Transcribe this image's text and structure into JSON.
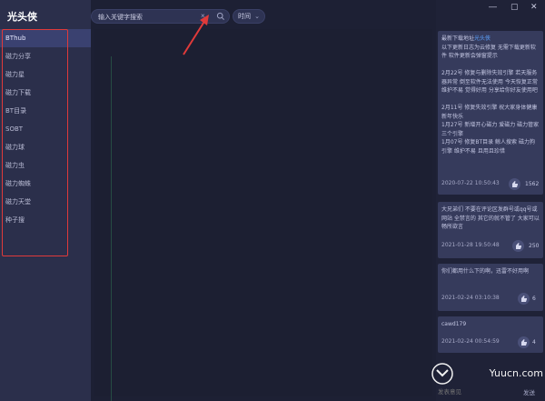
{
  "app": {
    "title": "光头侠"
  },
  "sidebar": {
    "items": [
      {
        "label": "BThub",
        "active": true
      },
      {
        "label": "磁力分享"
      },
      {
        "label": "磁力星"
      },
      {
        "label": "磁力下载"
      },
      {
        "label": "BT目录"
      },
      {
        "label": "SOBT"
      },
      {
        "label": "磁力球"
      },
      {
        "label": "磁力虫"
      },
      {
        "label": "磁力蜘蛛"
      },
      {
        "label": "磁力天堂"
      },
      {
        "label": "种子搜"
      }
    ],
    "highlight_color": "#e03a3a"
  },
  "search": {
    "placeholder": "输入关键字搜索",
    "sort_label": "时间"
  },
  "notices": [
    {
      "text_prefix": "最新下载地址",
      "link": "光头侠",
      "text": "\n以下更新日志为云修复 无需下载更新软件 软件更新会弹窗提示\n\n2月22号 修复与删除失效引擎 若天服务器异常 倒至软件无法使用 今天恢复正常 维护不易 觉得好用 分享给你好友使用吧\n\n2月11号 修复失效引擎 祝大家身体健康 新年快乐\n1月27号 新增开心磁力 爱磁力 磁力管家三个引擎\n1月07号 修复BT目录 鲸人搜索 磁力狗引擎 维护不易 且用且珍惜",
      "date": "2020-07-22 10:50:43",
      "likes": "1562"
    },
    {
      "text": "大兄弟们 不要在评论区发群号或qq号或网站 全禁言的 其它的就不管了 大家可以畅所欲言",
      "date": "2021-01-28 19:50:48",
      "likes": "250"
    },
    {
      "text": "你们都用什么下的啊，迅雷不好用啊",
      "date": "2021-02-24 03:10:38",
      "likes": "6"
    },
    {
      "text": "cawd179",
      "date": "2021-02-24 00:54:59",
      "likes": "4"
    }
  ],
  "feedback": {
    "placeholder": "发表意见",
    "send_label": "发送"
  },
  "window": {
    "minimize": "—",
    "maximize": "▢",
    "close": "✕"
  },
  "watermark": {
    "text": "Yuucn.com"
  },
  "colors": {
    "accent": "#3a4170",
    "link": "#5da3ff",
    "annotation": "#e03a3a"
  },
  "icons": [
    "search-icon",
    "clear-icon",
    "chevron-down-icon",
    "thumbs-up-icon",
    "minimize-icon",
    "maximize-icon",
    "close-icon"
  ]
}
